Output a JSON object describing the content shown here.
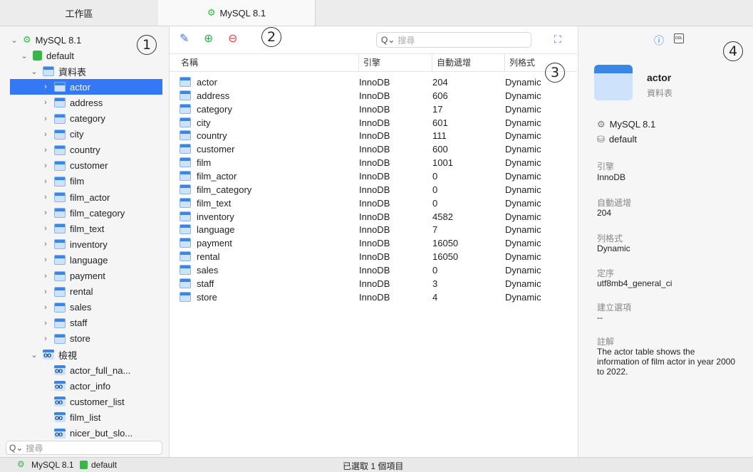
{
  "tabs": {
    "workspace": "工作區",
    "connection": "MySQL 8.1"
  },
  "sidebar": {
    "connection": "MySQL 8.1",
    "database": "default",
    "tables_group": "資料表",
    "tables": [
      "actor",
      "address",
      "category",
      "city",
      "country",
      "customer",
      "film",
      "film_actor",
      "film_category",
      "film_text",
      "inventory",
      "language",
      "payment",
      "rental",
      "sales",
      "staff",
      "store"
    ],
    "views_group": "檢視",
    "views": [
      "actor_full_na...",
      "actor_info",
      "customer_list",
      "film_list",
      "nicer_but_slo..."
    ],
    "search_placeholder": "搜尋",
    "selected": "actor"
  },
  "toolbar": {
    "search_placeholder": "搜尋"
  },
  "table": {
    "headers": [
      "名稱",
      "引擎",
      "自動遞增",
      "列格式"
    ],
    "rows": [
      [
        "actor",
        "InnoDB",
        "204",
        "Dynamic"
      ],
      [
        "address",
        "InnoDB",
        "606",
        "Dynamic"
      ],
      [
        "category",
        "InnoDB",
        "17",
        "Dynamic"
      ],
      [
        "city",
        "InnoDB",
        "601",
        "Dynamic"
      ],
      [
        "country",
        "InnoDB",
        "111",
        "Dynamic"
      ],
      [
        "customer",
        "InnoDB",
        "600",
        "Dynamic"
      ],
      [
        "film",
        "InnoDB",
        "1001",
        "Dynamic"
      ],
      [
        "film_actor",
        "InnoDB",
        "0",
        "Dynamic"
      ],
      [
        "film_category",
        "InnoDB",
        "0",
        "Dynamic"
      ],
      [
        "film_text",
        "InnoDB",
        "0",
        "Dynamic"
      ],
      [
        "inventory",
        "InnoDB",
        "4582",
        "Dynamic"
      ],
      [
        "language",
        "InnoDB",
        "7",
        "Dynamic"
      ],
      [
        "payment",
        "InnoDB",
        "16050",
        "Dynamic"
      ],
      [
        "rental",
        "InnoDB",
        "16050",
        "Dynamic"
      ],
      [
        "sales",
        "InnoDB",
        "0",
        "Dynamic"
      ],
      [
        "staff",
        "InnoDB",
        "3",
        "Dynamic"
      ],
      [
        "store",
        "InnoDB",
        "4",
        "Dynamic"
      ]
    ]
  },
  "inspector": {
    "object_name": "actor",
    "object_type": "資料表",
    "connection": "MySQL 8.1",
    "database": "default",
    "engine_label": "引擎",
    "engine_value": "InnoDB",
    "auto_inc_label": "自動遞增",
    "auto_inc_value": "204",
    "row_format_label": "列格式",
    "row_format_value": "Dynamic",
    "collation_label": "定序",
    "collation_value": "utf8mb4_general_ci",
    "create_options_label": "建立選項",
    "create_options_value": "--",
    "comment_label": "註解",
    "comment_value": "The actor table shows the information of film actor in year 2000 to 2022.",
    "ddl_icon_text": "DDL"
  },
  "statusbar": {
    "connection": "MySQL 8.1",
    "database": "default",
    "selection": "已選取 1 個項目"
  },
  "markers": [
    "1",
    "2",
    "3",
    "4"
  ],
  "colors": {
    "selection": "#3478f6",
    "add": "#34a853",
    "remove": "#e8453c",
    "info": "#3478f6",
    "db": "#3bb54a"
  }
}
